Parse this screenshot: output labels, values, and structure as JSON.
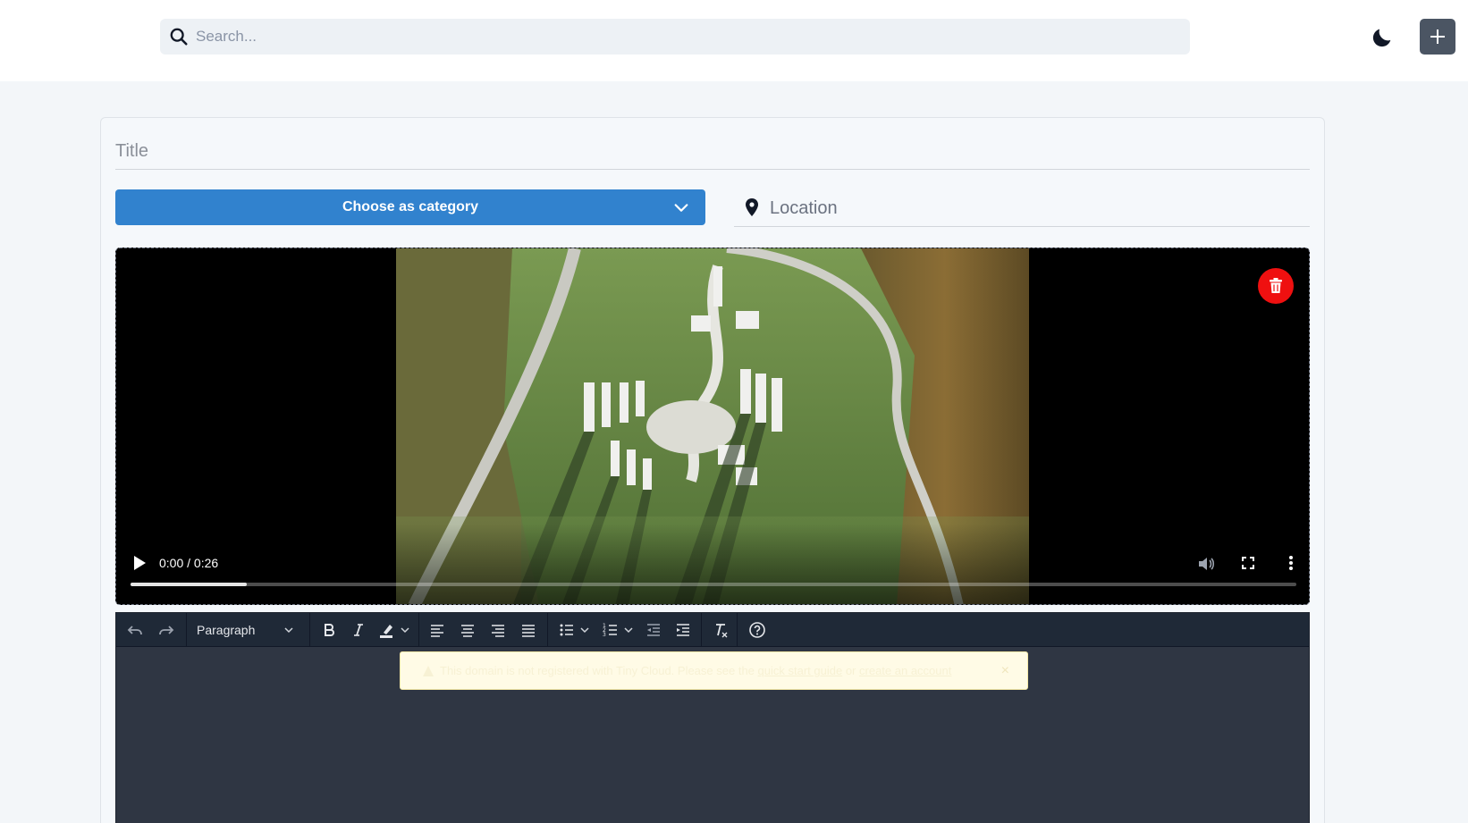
{
  "header": {
    "search_placeholder": "Search...",
    "theme_toggle_icon": "moon-icon",
    "add_button_icon": "plus-icon"
  },
  "form": {
    "title_placeholder": "Title",
    "category_label": "Choose as category",
    "location_placeholder": "Location"
  },
  "video": {
    "time": "0:00 / 0:26",
    "progress": 0.1,
    "delete_color": "#ef1010"
  },
  "editor": {
    "undo_icon": "undo-icon",
    "redo_icon": "redo-icon",
    "block_format": "Paragraph",
    "notice": {
      "text": "This domain is not registered with Tiny Cloud. Please see the",
      "link1": "quick start guide",
      "mid": "or",
      "link2": "create an account",
      "close": "×"
    }
  },
  "colors": {
    "accent": "#3182ce",
    "editor_bg": "#2f3643",
    "toolbar_bg": "#1f2937"
  }
}
